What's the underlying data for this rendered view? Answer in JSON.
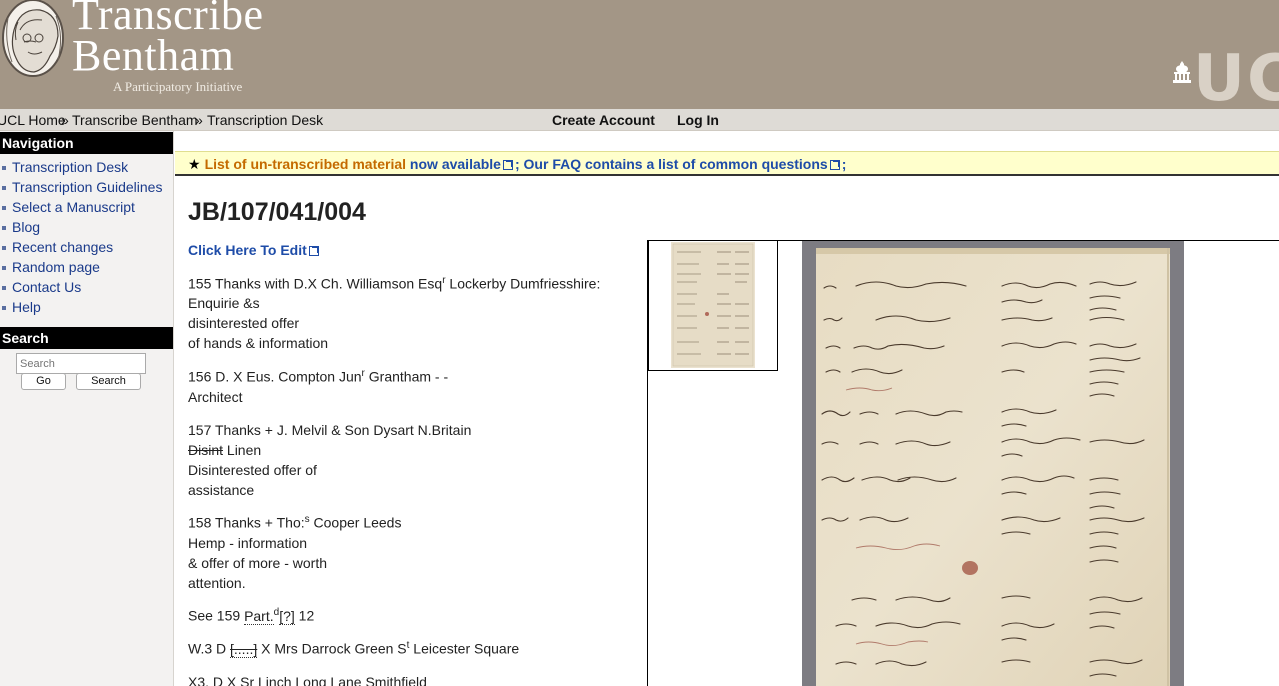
{
  "header": {
    "title_line1": "Transcribe",
    "title_line2": "Bentham",
    "subtitle": "A Participatory Initiative",
    "ucl_logo_text": "UC"
  },
  "breadcrumb": {
    "items": [
      "UCL Home",
      "Transcribe Bentham",
      "Transcription Desk"
    ],
    "separator": "»"
  },
  "account": {
    "create_account": "Create Account",
    "log_in": "Log In"
  },
  "sidebar": {
    "nav_heading": "Navigation",
    "items": [
      {
        "label": "Transcription Desk"
      },
      {
        "label": "Transcription Guidelines"
      },
      {
        "label": "Select a Manuscript"
      },
      {
        "label": "Blog"
      },
      {
        "label": "Recent changes"
      },
      {
        "label": "Random page"
      },
      {
        "label": "Contact Us"
      },
      {
        "label": "Help"
      }
    ],
    "search_heading": "Search",
    "search_placeholder": "Search",
    "go_button": "Go",
    "search_button": "Search"
  },
  "notice": {
    "star": "★",
    "part1": "List of un-transcribed material",
    "part2": " now available",
    "sep": "; ",
    "part3": "Our FAQ contains a list of common questions",
    "end": ";"
  },
  "page": {
    "title": "JB/107/041/004",
    "edit_link": "Click Here To Edit"
  },
  "transcript": {
    "e155_a": "155 Thanks with D.X Ch. Williamson Esq",
    "e155_sup": "r",
    "e155_b": " Lockerby Dumfriesshire:",
    "e155_l2": "Enquirie &s",
    "e155_l3": "disinterested offer",
    "e155_l4": "of hands & information",
    "e156_a": "156 D. X Eus. Compton Jun",
    "e156_sup": "r",
    "e156_b": " Grantham - -",
    "e156_l2": "Architect",
    "e157_l1": "157 Thanks + J. Melvil & Son Dysart N.Britain",
    "e157_del": "Disint",
    "e157_l2b": " Linen",
    "e157_l3": "Disinterested offer of",
    "e157_l4": "assistance",
    "e158_a": "158 Thanks + Tho:",
    "e158_sup": "s",
    "e158_b": " Cooper Leeds",
    "e158_l2": "Hemp - information",
    "e158_l3": "& offer of more - worth",
    "e158_l4": "attention.",
    "see_a": "See 159 ",
    "see_part": "Part.",
    "see_sup": "d",
    "see_q": "[?]",
    "see_b": " 12",
    "w3_a": "W.3 D ",
    "w3_del": "[.....]",
    "w3_b": " X Mrs Darrock Green S",
    "w3_sup": "t",
    "w3_c": " Leicester Square",
    "x3": "X3. D X Sr Linch Long Lane Smithfield"
  },
  "colors": {
    "header_bg": "#a39686",
    "link_blue": "#1e4ca8",
    "notice_bg": "#ffffcc",
    "notice_orange": "#c46a00"
  }
}
